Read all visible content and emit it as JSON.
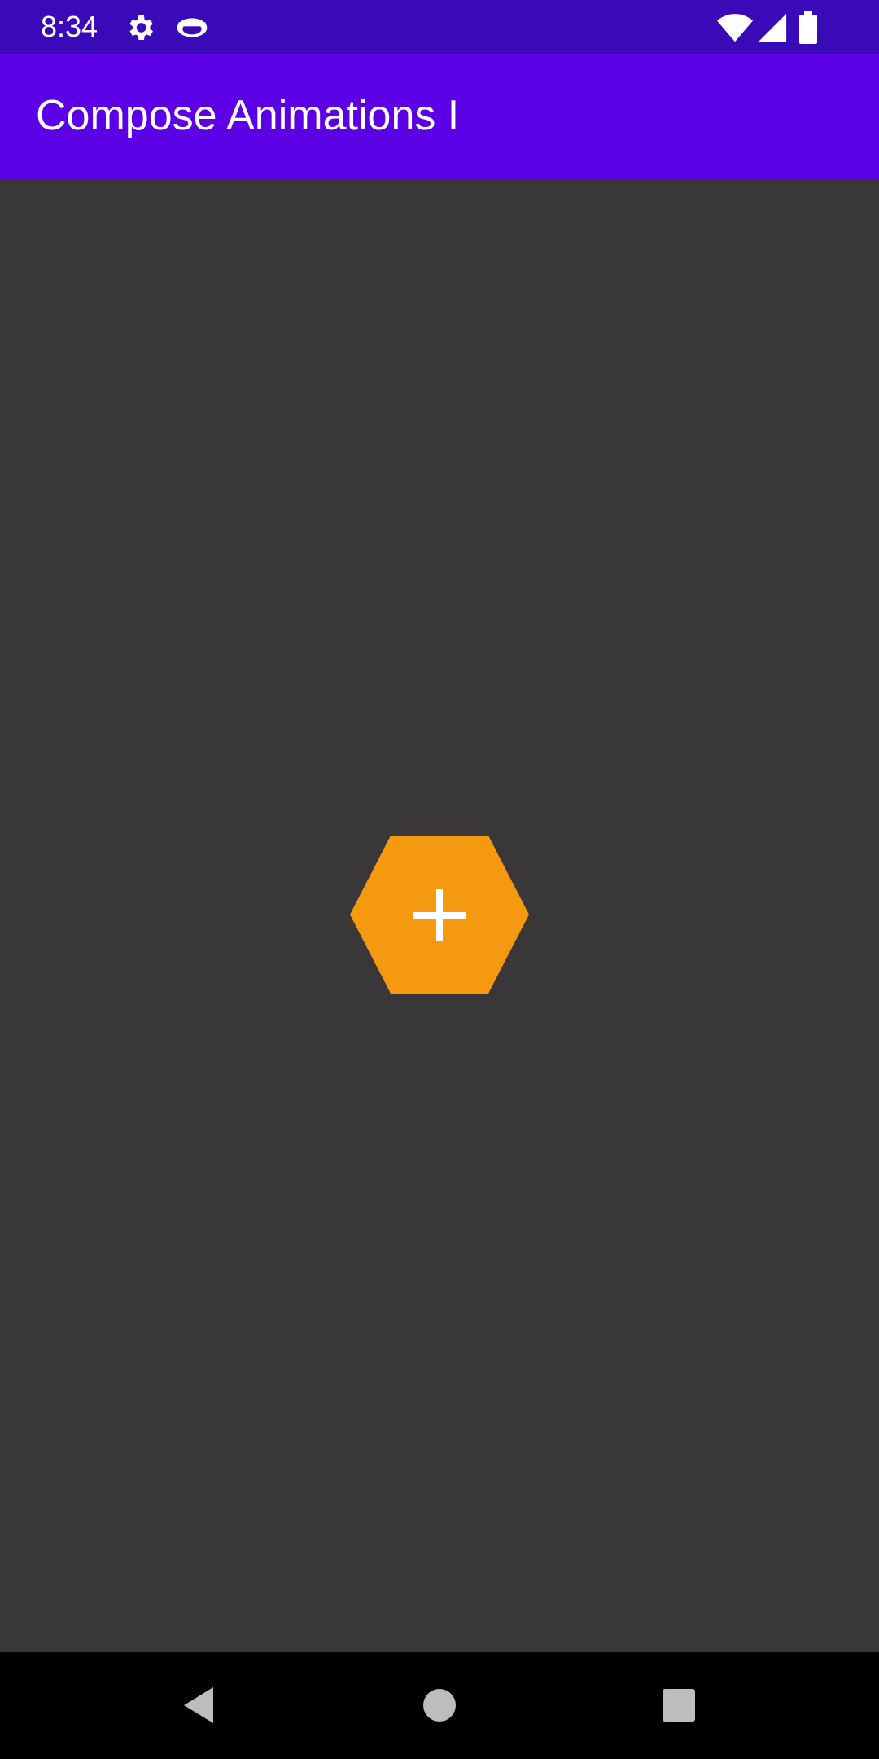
{
  "status_bar": {
    "time": "8:34",
    "icons": [
      "gear-icon",
      "eye-icon",
      "wifi-icon",
      "signal-icon",
      "battery-icon"
    ]
  },
  "app_bar": {
    "title": "Compose Animations I"
  },
  "fab": {
    "icon": "plus-icon",
    "shape": "hexagon",
    "color": "#f59a10"
  },
  "nav_bar": {
    "buttons": [
      "back-icon",
      "home-icon",
      "recents-icon"
    ]
  },
  "colors": {
    "status_bar": "#3b0ab8",
    "app_bar": "#5c00e6",
    "background": "#3a3739",
    "accent": "#f59a10"
  }
}
